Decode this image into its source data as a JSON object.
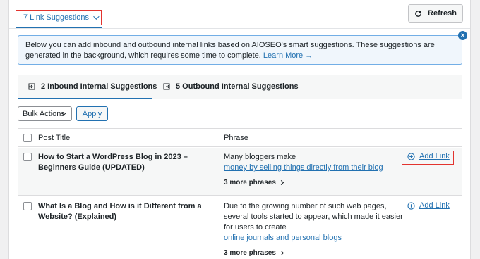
{
  "header": {
    "suggestions_toggle": "7 Link Suggestions",
    "refresh_label": "Refresh"
  },
  "notice": {
    "text": "Below you can add inbound and outbound internal links based on AIOSEO's smart suggestions. These suggestions are generated in the background, which requires some time to complete.",
    "link": "Learn More →"
  },
  "tabs": [
    {
      "label": "2 Inbound Internal Suggestions",
      "active": true
    },
    {
      "label": "5 Outbound Internal Suggestions",
      "active": false
    }
  ],
  "bulk": {
    "select_value": "Bulk Actions",
    "apply_label": "Apply"
  },
  "table": {
    "columns": [
      "Post Title",
      "Phrase"
    ],
    "rows": [
      {
        "title_line1": "How to Start a WordPress Blog in 2023 –",
        "title_line2": "Beginners Guide (UPDATED)",
        "phrase_lines": [
          "Many bloggers make"
        ],
        "phrase_link": "money by selling things directly from their blog",
        "more": "3 more phrases",
        "action": "Add Link"
      },
      {
        "title_line1": "What Is a Blog and How is it Different from a",
        "title_line2": "Website? (Explained)",
        "phrase_lines": [
          "Due to the growing number of such web pages,",
          "several tools started to appear, which made it easier",
          "for users to create"
        ],
        "phrase_link": "online journals and personal blogs",
        "more": "3 more phrases",
        "action": "Add Link"
      }
    ]
  },
  "colors": {
    "accent": "#2271b1",
    "highlight_border": "#e3342f",
    "notice_bg": "#f0f6fc"
  },
  "icons": [
    "refresh-icon",
    "close-icon",
    "inbound-icon",
    "outbound-icon",
    "chevron-down-icon",
    "plus-circle-icon",
    "chevron-right-icon"
  ]
}
